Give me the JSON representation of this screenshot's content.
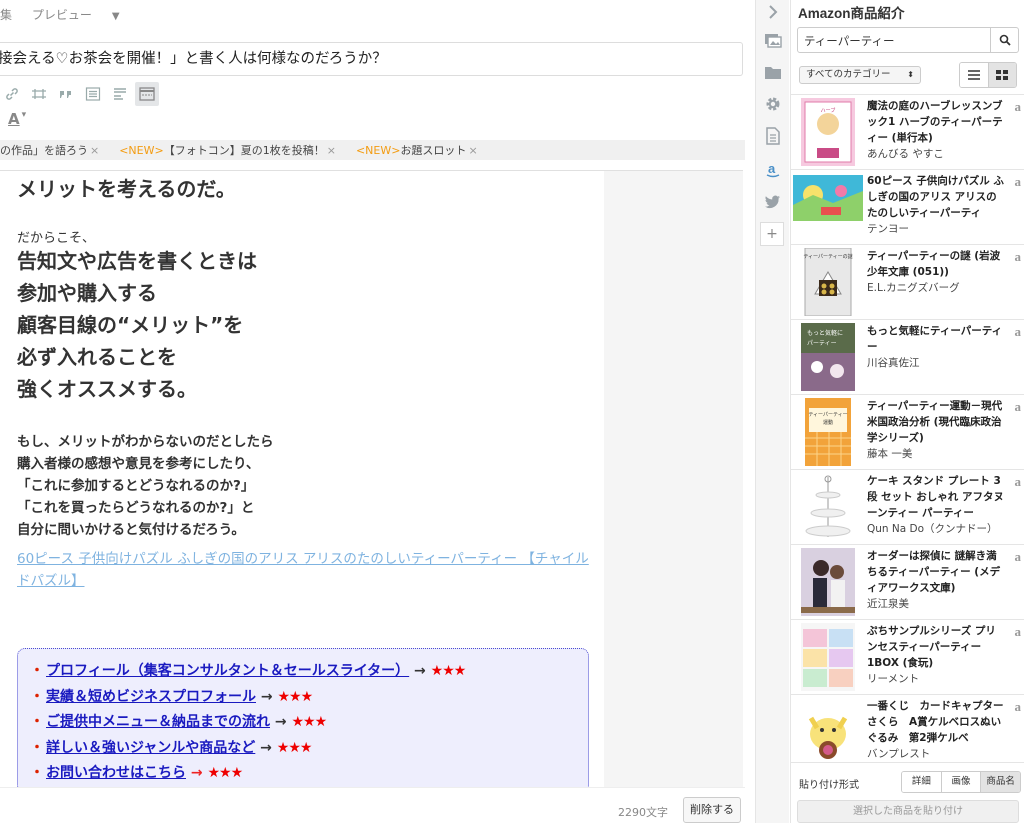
{
  "editor": {
    "tabs": [
      "集",
      "プレビュー"
    ],
    "title": "接会える♡お茶会を開催！」と書く人は何様なのだろうか？",
    "tags": [
      {
        "new": "",
        "text": "の作品」を語ろう",
        "x": "×"
      },
      {
        "new": "<NEW>",
        "text": "【フォトコン】夏の1枚を投稿！",
        "x": "×"
      },
      {
        "new": "<NEW>",
        "text": "お題スロット",
        "x": "×"
      }
    ],
    "font_color_label": "A",
    "body": {
      "heading": "メリットを考えるのだ。",
      "small": "だからこそ、",
      "big_lines": [
        "告知文や広告を書くときは",
        "参加や購入する",
        "顧客目線の“メリット”を",
        "必ず入れることを",
        "強くオススメする。"
      ],
      "para_lines": [
        "もし、メリットがわからないのだとしたら",
        "購入者様の感想や意見を参考にしたり、",
        "「これに参加するとどうなれるのか?」",
        "「これを買ったらどうなれるのか?」と",
        "自分に問いかけると気付けるだろう。"
      ],
      "link": "60ピース 子供向けパズル ふしぎの国のアリス アリスのたのしいティーパーティー 【チャイルドパズル】",
      "box_rows": [
        {
          "bullet": "・",
          "text": "プロフィール（集客コンサルタント＆セールスライター）",
          "arrow": " → ",
          "stars": "★★★"
        },
        {
          "bullet": "・",
          "text": "実績＆短めビジネスプロフォール",
          "arrow": " → ",
          "stars": "★★★"
        },
        {
          "bullet": "・",
          "text": "ご提供中メニュー＆納品までの流れ",
          "arrow": " → ",
          "stars": "★★★"
        },
        {
          "bullet": "・",
          "text": "詳しい＆強いジャンルや商品など",
          "arrow": " → ",
          "stars": "★★★"
        },
        {
          "bullet": "・",
          "text": "お問い合わせはこちら",
          "arrow": " → ",
          "stars": "★★★"
        }
      ]
    },
    "char_count": "2290文字",
    "delete_label": "削除する"
  },
  "panel": {
    "title": "Amazon商品紹介",
    "search_value": "ティーパーティー",
    "category": "すべてのカテゴリー",
    "products": [
      {
        "title": "魔法の庭のハーブレッスンブック1 ハーブのティーパーティー (単行本)",
        "author": "あんびる やすこ",
        "thumb": "book-pink"
      },
      {
        "title": "60ピース 子供向けパズル ふしぎの国のアリス アリスのたのしいティーパーティ",
        "author": "テンヨー",
        "thumb": "puzzle"
      },
      {
        "title": "ティーパーティーの謎 (岩波少年文庫 (051))",
        "author": "E.L.カニグズバーグ",
        "thumb": "book-gray"
      },
      {
        "title": "もっと気軽にティーパーティー",
        "author": "川谷真佐江",
        "thumb": "book-photo"
      },
      {
        "title": "ティーパーティー運動－現代米国政治分析 (現代臨床政治学シリーズ)",
        "author": "藤本 一美",
        "thumb": "book-orange"
      },
      {
        "title": "ケーキ スタンド プレート 3段 セット おしゃれ アフタヌーンティー パーティー",
        "author": "Qun Na Do（クンナドー）",
        "thumb": "stand"
      },
      {
        "title": "オーダーは探偵に 謎解き満ちるティーパーティー (メディアワークス文庫)",
        "author": "近江泉美",
        "thumb": "book-anime"
      },
      {
        "title": "ぷちサンプルシリーズ プリンセスティーパーティー 1BOX (食玩)",
        "author": "リーメント",
        "thumb": "box"
      },
      {
        "title": "一番くじ　カードキャプターさくら　A賞ケルベロスぬいぐるみ　第2弾ケルベ",
        "author": "バンプレスト",
        "thumb": "plush"
      }
    ],
    "paste_format_label": "貼り付け形式",
    "formats": [
      "詳細",
      "画像",
      "商品名"
    ],
    "paste_button": "選択した商品を貼り付け",
    "amz_glyph": "a"
  }
}
